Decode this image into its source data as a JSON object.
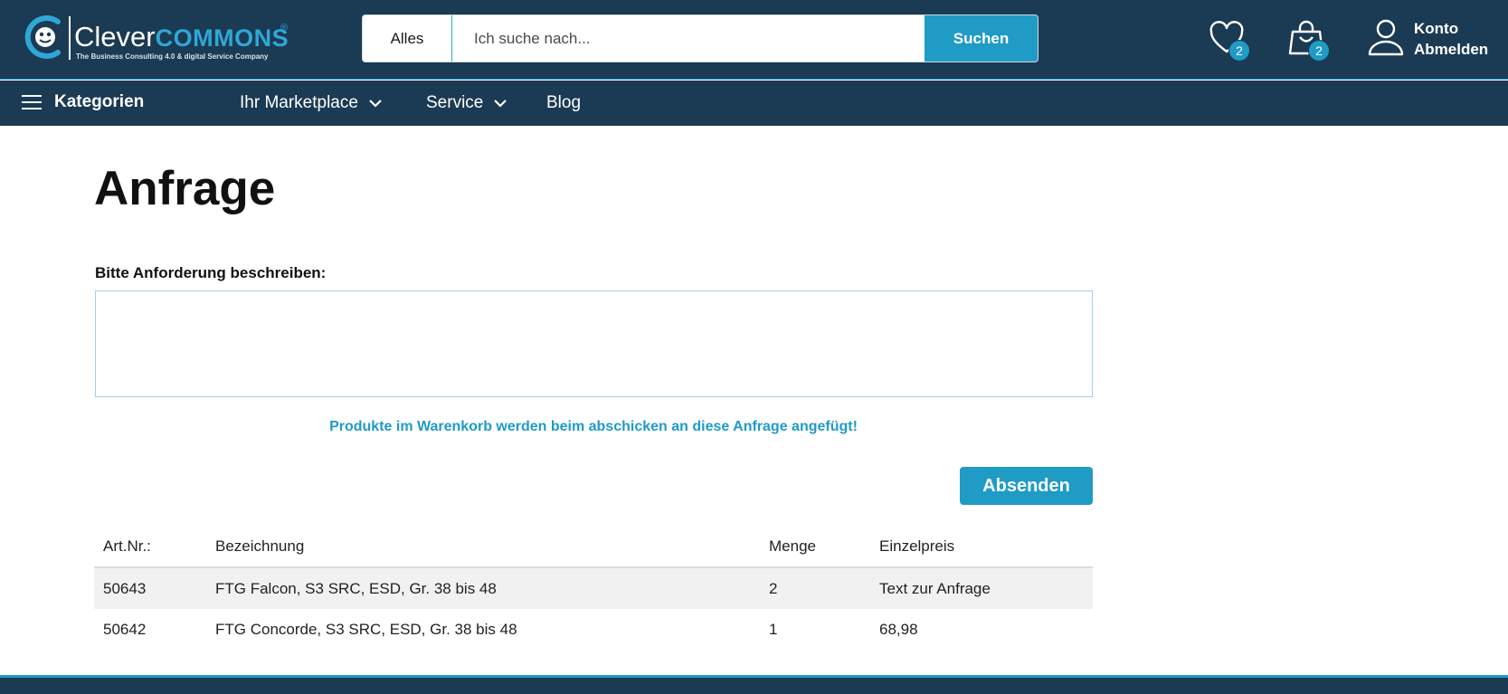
{
  "brand": {
    "name_main": "Clever",
    "name_accent": "COMMONS",
    "registered": "®",
    "tagline": "The Business Consulting 4.0 & digital Service Company"
  },
  "search": {
    "category": "Alles",
    "placeholder": "Ich suche nach...",
    "button_label": "Suchen"
  },
  "header": {
    "wishlist_count": "2",
    "cart_count": "2",
    "account_label": "Konto",
    "logout_label": "Abmelden"
  },
  "nav": {
    "categories_label": "Kategorien",
    "items": [
      {
        "label": "Ihr Marketplace",
        "has_dropdown": true
      },
      {
        "label": "Service",
        "has_dropdown": true
      },
      {
        "label": "Blog",
        "has_dropdown": false
      }
    ]
  },
  "page": {
    "title": "Anfrage",
    "field_label": "Bitte Anforderung beschreiben:",
    "textarea_value": "",
    "note": "Produkte im Warenkorb werden beim abschicken an diese Anfrage angefügt!",
    "submit_label": "Absenden"
  },
  "table": {
    "headers": [
      "Art.Nr.:",
      "Bezeichnung",
      "Menge",
      "Einzelpreis"
    ],
    "rows": [
      {
        "art_nr": "50643",
        "name": "FTG Falcon, S3 SRC, ESD, Gr. 38 bis 48",
        "qty": "2",
        "price": "Text zur Anfrage"
      },
      {
        "art_nr": "50642",
        "name": "FTG Concorde, S3 SRC, ESD, Gr. 38 bis 48",
        "qty": "1",
        "price": "68,98"
      }
    ]
  },
  "colors": {
    "header_bg": "#1b3a53",
    "accent": "#1f9bc6",
    "row_shade": "#f1f1f1"
  },
  "icons": [
    "logo-mark",
    "heart-icon",
    "shopping-bag-icon",
    "user-icon",
    "hamburger-menu-icon",
    "chevron-down-icon"
  ]
}
